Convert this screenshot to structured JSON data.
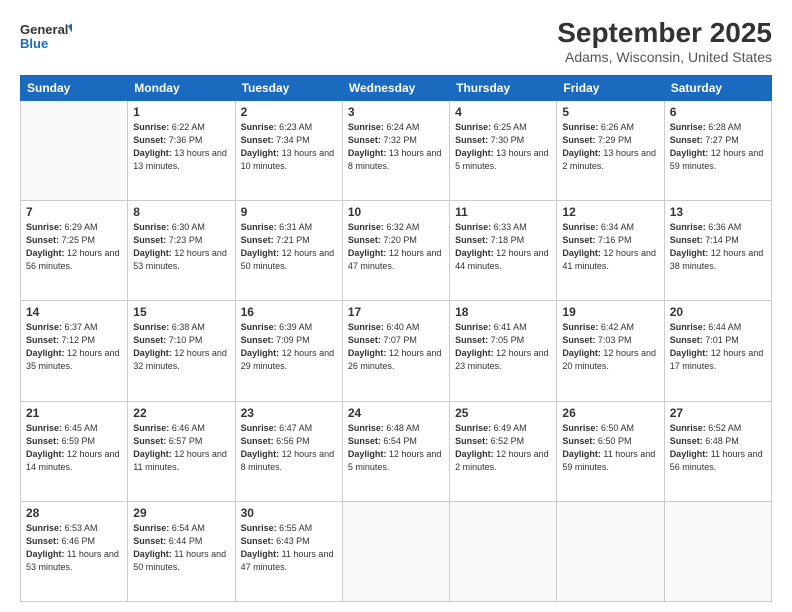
{
  "header": {
    "logo_line1": "General",
    "logo_line2": "Blue",
    "month": "September 2025",
    "location": "Adams, Wisconsin, United States"
  },
  "weekdays": [
    "Sunday",
    "Monday",
    "Tuesday",
    "Wednesday",
    "Thursday",
    "Friday",
    "Saturday"
  ],
  "weeks": [
    [
      {
        "day": "",
        "sunrise": "",
        "sunset": "",
        "daylight": ""
      },
      {
        "day": "1",
        "sunrise": "6:22 AM",
        "sunset": "7:36 PM",
        "daylight": "13 hours and 13 minutes."
      },
      {
        "day": "2",
        "sunrise": "6:23 AM",
        "sunset": "7:34 PM",
        "daylight": "13 hours and 10 minutes."
      },
      {
        "day": "3",
        "sunrise": "6:24 AM",
        "sunset": "7:32 PM",
        "daylight": "13 hours and 8 minutes."
      },
      {
        "day": "4",
        "sunrise": "6:25 AM",
        "sunset": "7:30 PM",
        "daylight": "13 hours and 5 minutes."
      },
      {
        "day": "5",
        "sunrise": "6:26 AM",
        "sunset": "7:29 PM",
        "daylight": "13 hours and 2 minutes."
      },
      {
        "day": "6",
        "sunrise": "6:28 AM",
        "sunset": "7:27 PM",
        "daylight": "12 hours and 59 minutes."
      }
    ],
    [
      {
        "day": "7",
        "sunrise": "6:29 AM",
        "sunset": "7:25 PM",
        "daylight": "12 hours and 56 minutes."
      },
      {
        "day": "8",
        "sunrise": "6:30 AM",
        "sunset": "7:23 PM",
        "daylight": "12 hours and 53 minutes."
      },
      {
        "day": "9",
        "sunrise": "6:31 AM",
        "sunset": "7:21 PM",
        "daylight": "12 hours and 50 minutes."
      },
      {
        "day": "10",
        "sunrise": "6:32 AM",
        "sunset": "7:20 PM",
        "daylight": "12 hours and 47 minutes."
      },
      {
        "day": "11",
        "sunrise": "6:33 AM",
        "sunset": "7:18 PM",
        "daylight": "12 hours and 44 minutes."
      },
      {
        "day": "12",
        "sunrise": "6:34 AM",
        "sunset": "7:16 PM",
        "daylight": "12 hours and 41 minutes."
      },
      {
        "day": "13",
        "sunrise": "6:36 AM",
        "sunset": "7:14 PM",
        "daylight": "12 hours and 38 minutes."
      }
    ],
    [
      {
        "day": "14",
        "sunrise": "6:37 AM",
        "sunset": "7:12 PM",
        "daylight": "12 hours and 35 minutes."
      },
      {
        "day": "15",
        "sunrise": "6:38 AM",
        "sunset": "7:10 PM",
        "daylight": "12 hours and 32 minutes."
      },
      {
        "day": "16",
        "sunrise": "6:39 AM",
        "sunset": "7:09 PM",
        "daylight": "12 hours and 29 minutes."
      },
      {
        "day": "17",
        "sunrise": "6:40 AM",
        "sunset": "7:07 PM",
        "daylight": "12 hours and 26 minutes."
      },
      {
        "day": "18",
        "sunrise": "6:41 AM",
        "sunset": "7:05 PM",
        "daylight": "12 hours and 23 minutes."
      },
      {
        "day": "19",
        "sunrise": "6:42 AM",
        "sunset": "7:03 PM",
        "daylight": "12 hours and 20 minutes."
      },
      {
        "day": "20",
        "sunrise": "6:44 AM",
        "sunset": "7:01 PM",
        "daylight": "12 hours and 17 minutes."
      }
    ],
    [
      {
        "day": "21",
        "sunrise": "6:45 AM",
        "sunset": "6:59 PM",
        "daylight": "12 hours and 14 minutes."
      },
      {
        "day": "22",
        "sunrise": "6:46 AM",
        "sunset": "6:57 PM",
        "daylight": "12 hours and 11 minutes."
      },
      {
        "day": "23",
        "sunrise": "6:47 AM",
        "sunset": "6:56 PM",
        "daylight": "12 hours and 8 minutes."
      },
      {
        "day": "24",
        "sunrise": "6:48 AM",
        "sunset": "6:54 PM",
        "daylight": "12 hours and 5 minutes."
      },
      {
        "day": "25",
        "sunrise": "6:49 AM",
        "sunset": "6:52 PM",
        "daylight": "12 hours and 2 minutes."
      },
      {
        "day": "26",
        "sunrise": "6:50 AM",
        "sunset": "6:50 PM",
        "daylight": "11 hours and 59 minutes."
      },
      {
        "day": "27",
        "sunrise": "6:52 AM",
        "sunset": "6:48 PM",
        "daylight": "11 hours and 56 minutes."
      }
    ],
    [
      {
        "day": "28",
        "sunrise": "6:53 AM",
        "sunset": "6:46 PM",
        "daylight": "11 hours and 53 minutes."
      },
      {
        "day": "29",
        "sunrise": "6:54 AM",
        "sunset": "6:44 PM",
        "daylight": "11 hours and 50 minutes."
      },
      {
        "day": "30",
        "sunrise": "6:55 AM",
        "sunset": "6:43 PM",
        "daylight": "11 hours and 47 minutes."
      },
      {
        "day": "",
        "sunrise": "",
        "sunset": "",
        "daylight": ""
      },
      {
        "day": "",
        "sunrise": "",
        "sunset": "",
        "daylight": ""
      },
      {
        "day": "",
        "sunrise": "",
        "sunset": "",
        "daylight": ""
      },
      {
        "day": "",
        "sunrise": "",
        "sunset": "",
        "daylight": ""
      }
    ]
  ],
  "labels": {
    "sunrise": "Sunrise:",
    "sunset": "Sunset:",
    "daylight": "Daylight:"
  }
}
